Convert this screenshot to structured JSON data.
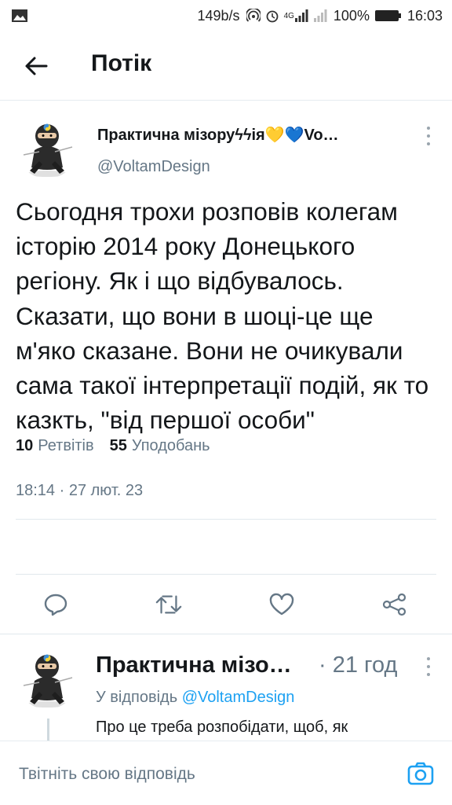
{
  "status_bar": {
    "network_speed": "149b/s",
    "signal_label": "4G",
    "battery": "100%",
    "time": "16:03"
  },
  "header": {
    "title": "Потік",
    "back_icon": "arrow-left-icon"
  },
  "tweet": {
    "author_name": "Практична мізоруϟϟія💛💙Vo…",
    "handle": "@VoltamDesign",
    "text": "Сьогодня трохи розповів колегам історію 2014 року Донецького регіону. Як і що відбувалось. Сказати, що вони в шоці-це ще м'яко сказане. Вони не очикували сама такої інтерпретації подій, як то казкть, \"від першої особи\"",
    "timestamp": "18:14 · 27 лют. 23",
    "retweets_count": "10",
    "retweets_label": "Ретвітів",
    "likes_count": "55",
    "likes_label": "Уподобань",
    "actions": [
      "reply-icon",
      "retweet-icon",
      "like-icon",
      "share-icon"
    ]
  },
  "reply": {
    "author_name": "Практична мізо…",
    "time": "· 21 год",
    "reply_to_prefix": "У відповідь",
    "reply_to_handle": "@VoltamDesign",
    "text": "Про це треба розпобідати, щоб, як"
  },
  "compose": {
    "placeholder": "Твітніть свою відповідь",
    "camera_icon": "camera-icon"
  },
  "colors": {
    "accent": "#1da1f2",
    "secondary_text": "#657786",
    "primary_text": "#14171a"
  }
}
